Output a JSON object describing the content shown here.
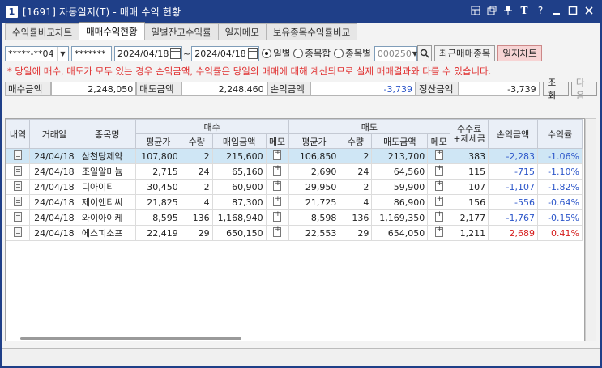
{
  "window": {
    "icon_num": "1",
    "title": "[1691] 자동일지(T) - 매매 수익 현황",
    "icons": [
      "layout-icon",
      "window-icon",
      "pin-icon",
      "font-icon",
      "help-icon",
      "minimize-icon",
      "maximize-icon",
      "close-icon"
    ]
  },
  "tabs": [
    {
      "label": "수익률비교차트",
      "active": false
    },
    {
      "label": "매매수익현황",
      "active": true
    },
    {
      "label": "일별잔고수익률",
      "active": false
    },
    {
      "label": "일지메모",
      "active": false
    },
    {
      "label": "보유종목수익률비교",
      "active": false
    }
  ],
  "controls": {
    "account": "*****-**04",
    "password": "*******",
    "date_from": "2024/04/18",
    "date_sep": "~",
    "date_to": "2024/04/18",
    "radio_daily": "일별",
    "radio_sum": "종목합",
    "radio_by_stock": "종목별",
    "stock_code": "000250",
    "btn_recent": "최근매매종목",
    "btn_chart": "일지차트"
  },
  "notice": "* 당일에 매수, 매도가 모두 있는 경우 손익금액, 수익률은 당일의 매매에 대해 계산되므로 실제 매매결과와 다를 수 있습니다.",
  "summary": {
    "buy_label": "매수금액",
    "buy_value": "2,248,050",
    "sell_label": "매도금액",
    "sell_value": "2,248,460",
    "pnl_label": "손익금액",
    "pnl_value": "-3,739",
    "settle_label": "정산금액",
    "settle_value": "-3,739",
    "btn_query": "조회",
    "btn_next": "다음"
  },
  "table": {
    "headers": {
      "detail": "내역",
      "date": "거래일",
      "name": "종목명",
      "buy_group": "매수",
      "sell_group": "매도",
      "fee": "수수료\n+제세금",
      "pnl": "손익금액",
      "rate": "수익률",
      "avg": "평균가",
      "qty": "수량",
      "buy_amt": "매입금액",
      "memo": "메모",
      "sell_amt": "매도금액"
    },
    "rows": [
      {
        "date": "24/04/18",
        "name": "삼천당제약",
        "b_avg": "107,800",
        "b_qty": "2",
        "b_amt": "215,600",
        "s_avg": "106,850",
        "s_qty": "2",
        "s_amt": "213,700",
        "fee": "383",
        "pnl": "-2,283",
        "rate": "-1.06%",
        "sign": "neg"
      },
      {
        "date": "24/04/18",
        "name": "조일알미늄",
        "b_avg": "2,715",
        "b_qty": "24",
        "b_amt": "65,160",
        "s_avg": "2,690",
        "s_qty": "24",
        "s_amt": "64,560",
        "fee": "115",
        "pnl": "-715",
        "rate": "-1.10%",
        "sign": "neg"
      },
      {
        "date": "24/04/18",
        "name": "디아이티",
        "b_avg": "30,450",
        "b_qty": "2",
        "b_amt": "60,900",
        "s_avg": "29,950",
        "s_qty": "2",
        "s_amt": "59,900",
        "fee": "107",
        "pnl": "-1,107",
        "rate": "-1.82%",
        "sign": "neg"
      },
      {
        "date": "24/04/18",
        "name": "제이앤티씨",
        "b_avg": "21,825",
        "b_qty": "4",
        "b_amt": "87,300",
        "s_avg": "21,725",
        "s_qty": "4",
        "s_amt": "86,900",
        "fee": "156",
        "pnl": "-556",
        "rate": "-0.64%",
        "sign": "neg"
      },
      {
        "date": "24/04/18",
        "name": "와이아이케",
        "b_avg": "8,595",
        "b_qty": "136",
        "b_amt": "1,168,940",
        "s_avg": "8,598",
        "s_qty": "136",
        "s_amt": "1,169,350",
        "fee": "2,177",
        "pnl": "-1,767",
        "rate": "-0.15%",
        "sign": "neg"
      },
      {
        "date": "24/04/18",
        "name": "에스피소프",
        "b_avg": "22,419",
        "b_qty": "29",
        "b_amt": "650,150",
        "s_avg": "22,553",
        "s_qty": "29",
        "s_amt": "654,050",
        "fee": "1,211",
        "pnl": "2,689",
        "rate": "0.41%",
        "sign": "pos"
      }
    ]
  }
}
